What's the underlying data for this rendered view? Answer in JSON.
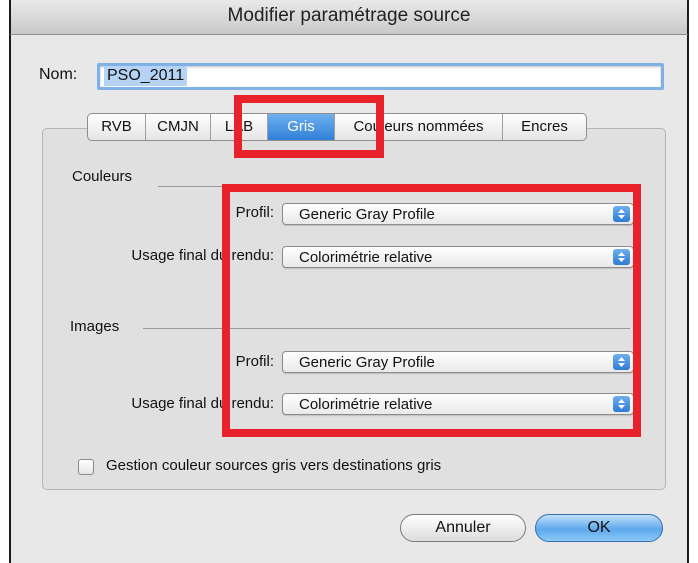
{
  "window": {
    "title": "Modifier paramétrage source"
  },
  "name": {
    "label": "Nom:",
    "value": "PSO_2011"
  },
  "tabs": [
    {
      "label": "RVB",
      "selected": false
    },
    {
      "label": "CMJN",
      "selected": false
    },
    {
      "label": "LAB",
      "selected": false
    },
    {
      "label": "Gris",
      "selected": true
    },
    {
      "label": "Couleurs nommées",
      "selected": false
    },
    {
      "label": "Encres",
      "selected": false
    }
  ],
  "couleurs": {
    "label": "Couleurs",
    "profil_label": "Profil:",
    "profil_value": "Generic Gray Profile",
    "usage_label": "Usage final du rendu:",
    "usage_value": "Colorimétrie relative"
  },
  "images": {
    "label": "Images",
    "profil_label": "Profil:",
    "profil_value": "Generic Gray Profile",
    "usage_label": "Usage final du rendu:",
    "usage_value": "Colorimétrie relative"
  },
  "gray_management": {
    "label": "Gestion couleur sources gris vers destinations gris",
    "checked": false
  },
  "buttons": {
    "cancel": "Annuler",
    "ok": "OK"
  },
  "colors": {
    "accent": "#2f7fd8",
    "highlight": "#b5d3f5",
    "annotation": "#e8212a"
  }
}
